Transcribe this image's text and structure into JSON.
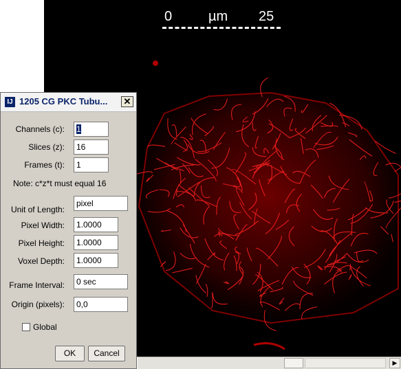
{
  "image_window": {
    "scalebar": {
      "start": "0",
      "unit": "µm",
      "end": "25"
    },
    "colors": {
      "background": "#000000",
      "signal": "#ff1a1a"
    },
    "scroll_right_glyph": "▶"
  },
  "dialog": {
    "icon_glyph": "IJ",
    "title": "1205 CG PKC Tubu...",
    "close_glyph": "✕",
    "fields": {
      "channels": {
        "label": "Channels (c):",
        "value": "1"
      },
      "slices": {
        "label": "Slices (z):",
        "value": "16"
      },
      "frames": {
        "label": "Frames (t):",
        "value": "1"
      },
      "unit_of_length": {
        "label": "Unit of Length:",
        "value": "pixel"
      },
      "pixel_width": {
        "label": "Pixel Width:",
        "value": "1.0000"
      },
      "pixel_height": {
        "label": "Pixel Height:",
        "value": "1.0000"
      },
      "voxel_depth": {
        "label": "Voxel Depth:",
        "value": "1.0000"
      },
      "frame_interval": {
        "label": "Frame Interval:",
        "value": "0 sec"
      },
      "origin": {
        "label": "Origin (pixels):",
        "value": "0,0"
      }
    },
    "note": "Note: c*z*t must equal 16",
    "global_label": "Global",
    "global_checked": false,
    "ok_label": "OK",
    "cancel_label": "Cancel"
  }
}
